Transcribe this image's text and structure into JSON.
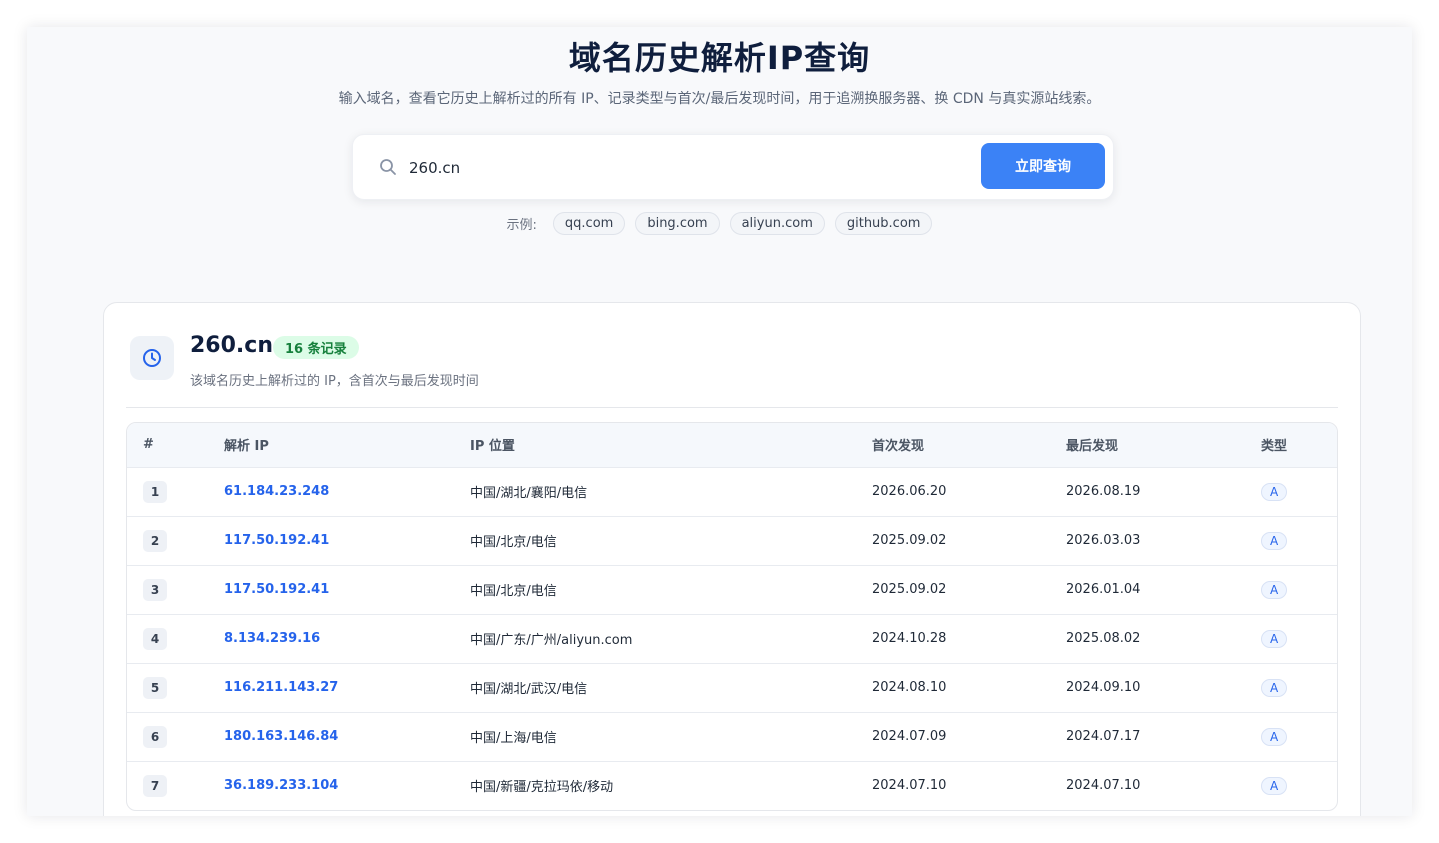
{
  "header": {
    "title": "域名历史解析IP查询",
    "subtitle": "输入域名，查看它历史上解析过的所有 IP、记录类型与首次/最后发现时间，用于追溯换服务器、换 CDN 与真实源站线索。"
  },
  "search": {
    "value": "260.cn",
    "button_label": "立即查询"
  },
  "examples": {
    "label": "示例:",
    "items": [
      "qq.com",
      "bing.com",
      "aliyun.com",
      "github.com"
    ]
  },
  "result": {
    "domain": "260.cn",
    "badge": "16 条记录",
    "description": "该域名历史上解析过的 IP，含首次与最后发现时间",
    "columns": [
      "#",
      "解析 IP",
      "IP 位置",
      "首次发现",
      "最后发现",
      "类型"
    ],
    "rows": [
      {
        "num": "1",
        "ip": "61.184.23.248",
        "location": "中国/湖北/襄阳/电信",
        "first": "2026.06.20",
        "last": "2026.08.19",
        "type": "A"
      },
      {
        "num": "2",
        "ip": "117.50.192.41",
        "location": "中国/北京/电信",
        "first": "2025.09.02",
        "last": "2026.03.03",
        "type": "A"
      },
      {
        "num": "3",
        "ip": "117.50.192.41",
        "location": "中国/北京/电信",
        "first": "2025.09.02",
        "last": "2026.01.04",
        "type": "A"
      },
      {
        "num": "4",
        "ip": "8.134.239.16",
        "location": "中国/广东/广州/aliyun.com",
        "first": "2024.10.28",
        "last": "2025.08.02",
        "type": "A"
      },
      {
        "num": "5",
        "ip": "116.211.143.27",
        "location": "中国/湖北/武汉/电信",
        "first": "2024.08.10",
        "last": "2024.09.10",
        "type": "A"
      },
      {
        "num": "6",
        "ip": "180.163.146.84",
        "location": "中国/上海/电信",
        "first": "2024.07.09",
        "last": "2024.07.17",
        "type": "A"
      },
      {
        "num": "7",
        "ip": "36.189.233.104",
        "location": "中国/新疆/克拉玛依/移动",
        "first": "2024.07.10",
        "last": "2024.07.10",
        "type": "A"
      }
    ]
  },
  "colors": {
    "accent": "#3b82f6",
    "link": "#2563eb",
    "badge_bg": "#dcfce7",
    "badge_text": "#16803c",
    "title": "#0f1e3d"
  },
  "icons": {
    "search": "search-icon",
    "clock": "clock-icon"
  }
}
